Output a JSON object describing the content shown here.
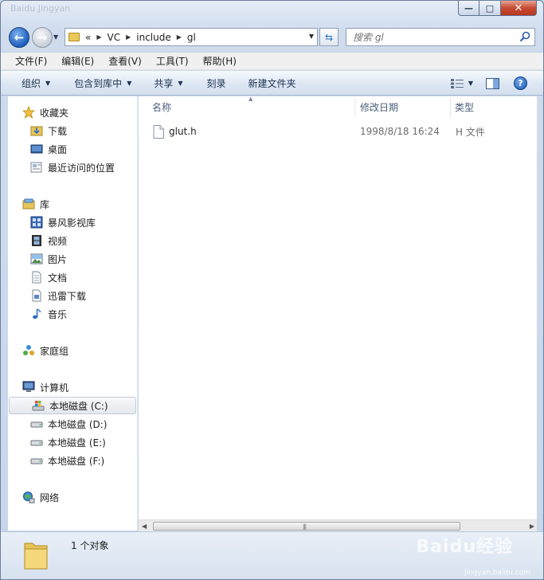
{
  "window": {
    "title_ghost": "Baidu Jingyan",
    "controls": {
      "minimize": "—",
      "maximize": "□",
      "close": "✕"
    }
  },
  "address": {
    "overflow": "«",
    "crumbs": [
      "VC",
      "include",
      "gl"
    ]
  },
  "search": {
    "placeholder": "搜索 gl"
  },
  "menu": [
    "文件(F)",
    "编辑(E)",
    "查看(V)",
    "工具(T)",
    "帮助(H)"
  ],
  "toolbar": {
    "organize": "组织",
    "include_in_library": "包含到库中",
    "share": "共享",
    "burn": "刻录",
    "new_folder": "新建文件夹"
  },
  "nav": {
    "favorites": {
      "label": "收藏夹",
      "items": [
        "下载",
        "桌面",
        "最近访问的位置"
      ]
    },
    "libraries": {
      "label": "库",
      "items": [
        "暴风影视库",
        "视频",
        "图片",
        "文档",
        "迅雷下载",
        "音乐"
      ]
    },
    "homegroup": {
      "label": "家庭组"
    },
    "computer": {
      "label": "计算机",
      "items": [
        "本地磁盘 (C:)",
        "本地磁盘 (D:)",
        "本地磁盘 (E:)",
        "本地磁盘 (F:)"
      ]
    },
    "network": {
      "label": "网络"
    }
  },
  "columns": {
    "name": "名称",
    "modified": "修改日期",
    "type": "类型"
  },
  "files": [
    {
      "name": "glut.h",
      "modified": "1998/8/18 16:24",
      "type": "H 文件"
    }
  ],
  "status": {
    "text": "1 个对象"
  },
  "watermark": {
    "text": "Baidu经验",
    "sub": "jingyan.baidu.com"
  },
  "colors": {
    "accent": "#1b5dbd",
    "selection": "#e5e8ed",
    "close": "#c74a32"
  }
}
